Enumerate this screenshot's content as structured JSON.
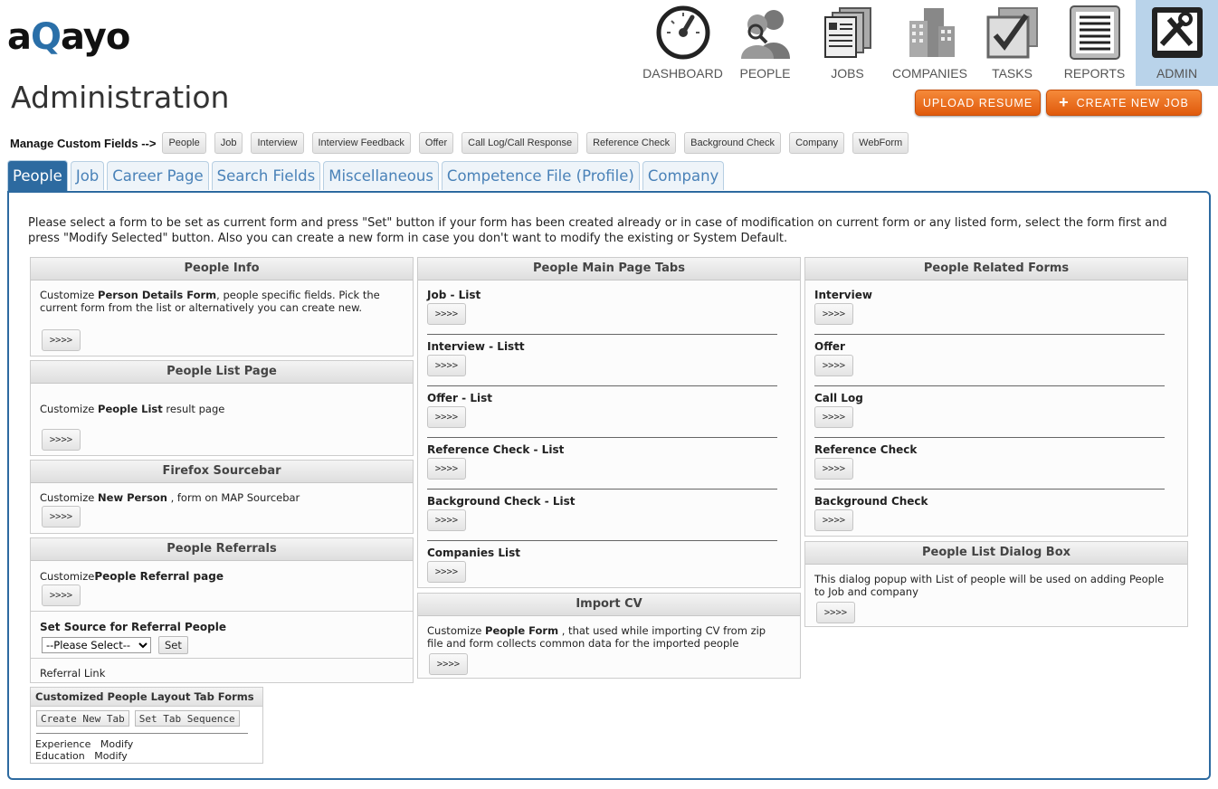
{
  "brand": {
    "logo_a": "a",
    "logo_q": "Q",
    "logo_rest": "ayo"
  },
  "nav": [
    {
      "label": "DASHBOARD",
      "icon": "dashboard-gauge-icon"
    },
    {
      "label": "PEOPLE",
      "icon": "people-icon"
    },
    {
      "label": "JOBS",
      "icon": "jobs-documents-icon"
    },
    {
      "label": "COMPANIES",
      "icon": "companies-buildings-icon"
    },
    {
      "label": "TASKS",
      "icon": "tasks-checkbox-icon"
    },
    {
      "label": "REPORTS",
      "icon": "reports-document-icon"
    },
    {
      "label": "ADMIN",
      "icon": "admin-tools-icon",
      "active": true
    }
  ],
  "page_title": "Administration",
  "actions": {
    "upload_resume": "UPLOAD RESUME",
    "create_job": "CREATE NEW JOB",
    "create_job_icon": "+"
  },
  "custom_fields": {
    "label": "Manage Custom Fields -->",
    "buttons": [
      "People",
      "Job",
      "Interview",
      "Interview Feedback",
      "Offer",
      "Call Log/Call Response",
      "Reference Check",
      "Background Check",
      "Company",
      "WebForm"
    ]
  },
  "tabs": [
    "People",
    "Job",
    "Career Page",
    "Search Fields",
    "Miscellaneous",
    "Competence File (Profile)",
    "Company"
  ],
  "intro": "Please select a form to be set as current form and press \"Set\" button if your form has been created already or in case of modification on current form or any listed form, select the form first and press \"Modify Selected\" button. Also you can create a new form in case you don't want to modify the existing or System Default.",
  "go_label": ">>>>",
  "col1": {
    "people_info": {
      "title": "People Info",
      "t1": "Customize ",
      "b1": "Person Details Form",
      "t2": ", people specific fields. Pick the current form from the list or alternatively you can create new."
    },
    "people_list": {
      "title": "People List Page",
      "t1": "Customize ",
      "b1": "People List",
      "t2": " result page"
    },
    "firefox": {
      "title": "Firefox Sourcebar",
      "t1": "Customize ",
      "b1": "New Person",
      "t2": " , form on MAP Sourcebar"
    },
    "referrals": {
      "title": "People Referrals",
      "t1": "Customize",
      "b1": "People Referral page",
      "set_source": "Set Source for Referral People",
      "select_value": "--Please Select--",
      "set_btn": "Set",
      "referral_link": "Referral Link"
    },
    "layout_tabs": {
      "title": "Customized People Layout Tab Forms",
      "create_btn": "Create New Tab",
      "sequence_btn": "Set Tab Sequence",
      "rows": [
        {
          "name": "Experience",
          "action": "Modify"
        },
        {
          "name": "Education",
          "action": "Modify"
        }
      ]
    }
  },
  "col2": {
    "main_tabs": {
      "title": "People Main Page Tabs",
      "items": [
        "Job - List",
        "Interview - Listt",
        "Offer - List",
        "Reference Check - List",
        "Background Check - List",
        "Companies List"
      ]
    },
    "import_cv": {
      "title": "Import CV",
      "t1": "Customize ",
      "b1": "People Form",
      "t2": " , that used while importing CV from zip file and form collects common data for the imported people"
    }
  },
  "col3": {
    "related": {
      "title": "People Related Forms",
      "items": [
        "Interview",
        "Offer",
        "Call Log",
        "Reference Check",
        "Background Check"
      ]
    },
    "dialog": {
      "title": "People List Dialog Box",
      "text": "This dialog popup with List of people will be used on adding People to Job and company"
    }
  }
}
